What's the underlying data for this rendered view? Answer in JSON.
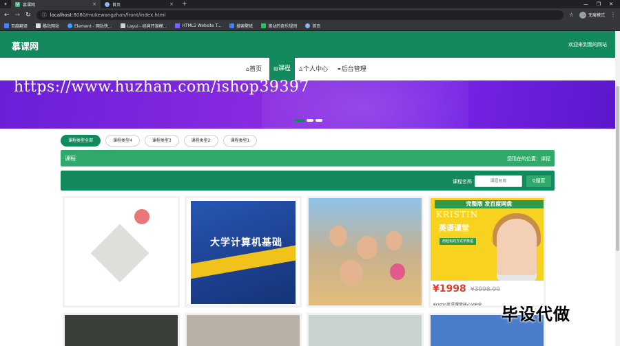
{
  "browser": {
    "tabs": [
      {
        "title": "慕课网",
        "active": true
      },
      {
        "title": "首页",
        "active": false
      }
    ],
    "new_tab": "+",
    "url_scheme": "localhost",
    "url_rest": ":8080/mukewangzhan/front/index.html",
    "profile_label": "无痕模式",
    "bookmarks": [
      "百度翻译",
      "酷站网站",
      "Element - 网站快...",
      "Layui - 经典开源模...",
      "HTML5 Website T...",
      "搜索壁纸",
      "滚动的奇乐规则",
      "首页"
    ]
  },
  "site": {
    "title": "慕课网",
    "welcome": "欢迎来到我的网站",
    "nav": [
      {
        "label": "首页",
        "icon": "home-icon"
      },
      {
        "label": "课程",
        "icon": "course-icon",
        "active": true
      },
      {
        "label": "个人中心",
        "icon": "user-icon"
      },
      {
        "label": "后台管理",
        "icon": "link-icon"
      }
    ]
  },
  "watermark": "https://www.huzhan.com/ishop39397",
  "filters": [
    "课程类型全部",
    "课程类型4",
    "课程类型3",
    "课程类型2",
    "课程类型1"
  ],
  "location": {
    "title": "课程",
    "path": "您现在的位置：课程"
  },
  "search": {
    "label": "课程名称",
    "placeholder": "课程名称",
    "button": "搜索"
  },
  "cards": {
    "book_title": "大学计算机基础",
    "kristin_top": "完整版 发百度网盘",
    "kristin_name": "KRISTIN",
    "kristin_course": "英语课堂",
    "kristin_tag": "用轻松的方式学英语",
    "kristin_price": "¥1998",
    "kristin_old_price": "¥3998.00",
    "kristin_desc": "Kristin英语课堂核心VIP全..."
  },
  "overlay_ad": "毕设代做",
  "colors": {
    "primary": "#138a5e",
    "secondary": "#2faa6a",
    "banner": "#7a24e6"
  }
}
